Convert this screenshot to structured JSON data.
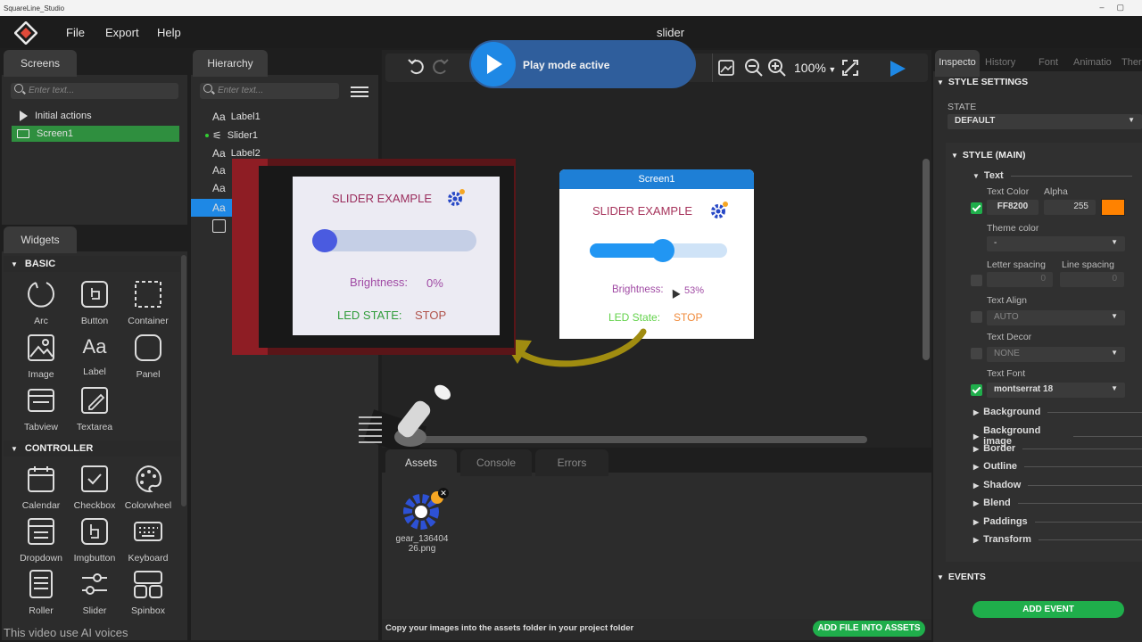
{
  "app": {
    "window_title": "SquareLine_Studio",
    "document_title": "slider"
  },
  "menu": [
    "File",
    "Export",
    "Help"
  ],
  "screens_panel": {
    "tab": "Screens",
    "search_placeholder": "Enter text...",
    "items": [
      "Initial actions",
      "Screen1"
    ]
  },
  "hierarchy_panel": {
    "tab": "Hierarchy",
    "search_placeholder": "Enter text...",
    "items": [
      "Label1",
      "Slider1",
      "Label2"
    ]
  },
  "widgets_panel": {
    "tab": "Widgets",
    "basic_title": "BASIC",
    "basic": [
      "Arc",
      "Button",
      "Container",
      "Image",
      "Label",
      "Panel",
      "Tabview",
      "Textarea"
    ],
    "controller_title": "CONTROLLER",
    "controller": [
      "Calendar",
      "Checkbox",
      "Colorwheel",
      "Dropdown",
      "Imgbutton",
      "Keyboard",
      "Roller",
      "Slider",
      "Spinbox"
    ]
  },
  "toolbar": {
    "play_mode": "Play mode active",
    "zoom": "100%"
  },
  "screen_preview": {
    "header": "Screen1",
    "title": "SLIDER EXAMPLE",
    "slider_value": 0.53,
    "brightness_label": "Brightness:",
    "brightness_value": "53%",
    "led_label": "LED State:",
    "led_value": "STOP"
  },
  "photo_display": {
    "title": "SLIDER EXAMPLE",
    "brightness_label": "Brightness:",
    "brightness_value": "0%",
    "led_label": "LED STATE:",
    "led_value": "STOP"
  },
  "bottom_panel": {
    "tabs": [
      "Assets",
      "Console",
      "Errors"
    ],
    "asset_name_line1": "gear_136404",
    "asset_name_line2": "26.png",
    "footer_text": "Copy your images into the assets folder in your project folder",
    "add_button": "ADD FILE INTO ASSETS"
  },
  "inspector": {
    "tabs": [
      "Inspecto",
      "History",
      "Font",
      "Animatio",
      "Ther"
    ],
    "style_settings": "STYLE SETTINGS",
    "state_label": "STATE",
    "state_value": "DEFAULT",
    "style_main": "STYLE (MAIN)",
    "text_section": "Text",
    "text_color_label": "Text Color",
    "alpha_label": "Alpha",
    "text_color_value": "FF8200",
    "alpha_value": "255",
    "swatch_color": "#ff8200",
    "theme_color_label": "Theme color",
    "theme_color_value": "-",
    "letter_spacing_label": "Letter spacing",
    "line_spacing_label": "Line spacing",
    "letter_spacing_value": "0",
    "line_spacing_value": "0",
    "text_align_label": "Text Align",
    "text_align_value": "AUTO",
    "text_decor_label": "Text Decor",
    "text_decor_value": "NONE",
    "text_font_label": "Text Font",
    "text_font_value": "montserrat 18",
    "collapsed_sections": [
      "Background",
      "Background image",
      "Border",
      "Outline",
      "Shadow",
      "Blend",
      "Paddings",
      "Transform"
    ],
    "events_title": "EVENTS",
    "add_event_button": "ADD EVENT"
  },
  "watermark": "This video use AI voices",
  "colors": {
    "accent_green": "#1fae4b",
    "accent_blue": "#1e88e5",
    "play_bar": "#2f5e9c"
  }
}
